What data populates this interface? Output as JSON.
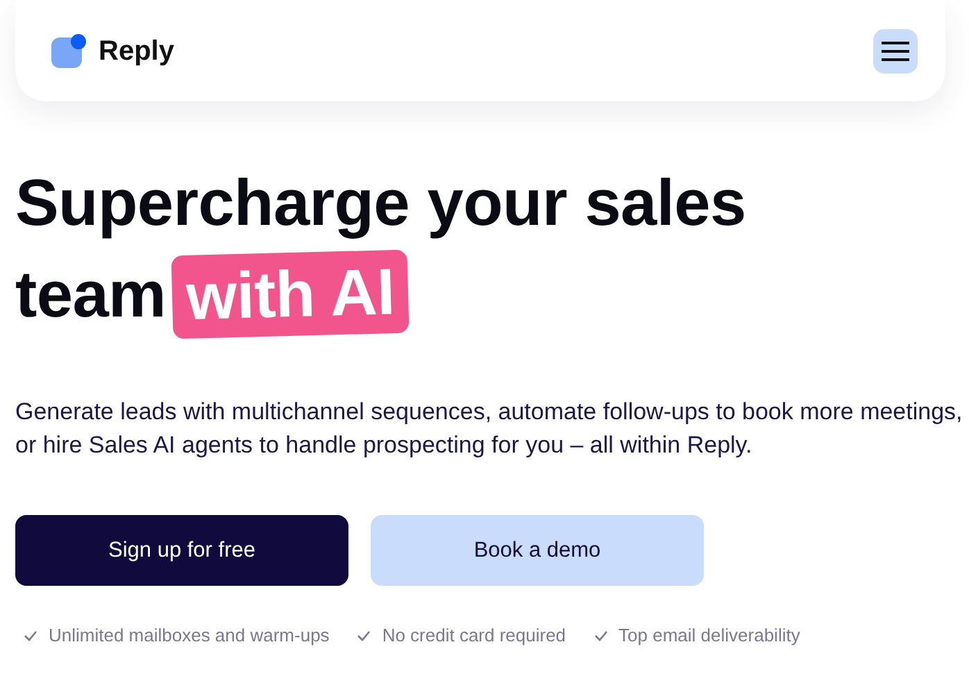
{
  "header": {
    "brand": "Reply"
  },
  "hero": {
    "headline_lines": [
      "Supercharge your sales",
      "team"
    ],
    "highlight": "with AI",
    "description": "Generate leads with multichannel sequences, automate follow-ups to book more meetings, or hire Sales AI agents to handle prospecting for you – all within Reply.",
    "buttons": [
      {
        "label": "Sign up for free",
        "kind": "primary"
      },
      {
        "label": "Book a demo",
        "kind": "secondary"
      }
    ],
    "features": [
      "Unlimited mailboxes and warm-ups",
      "No credit card required",
      "Top email deliverability"
    ]
  }
}
